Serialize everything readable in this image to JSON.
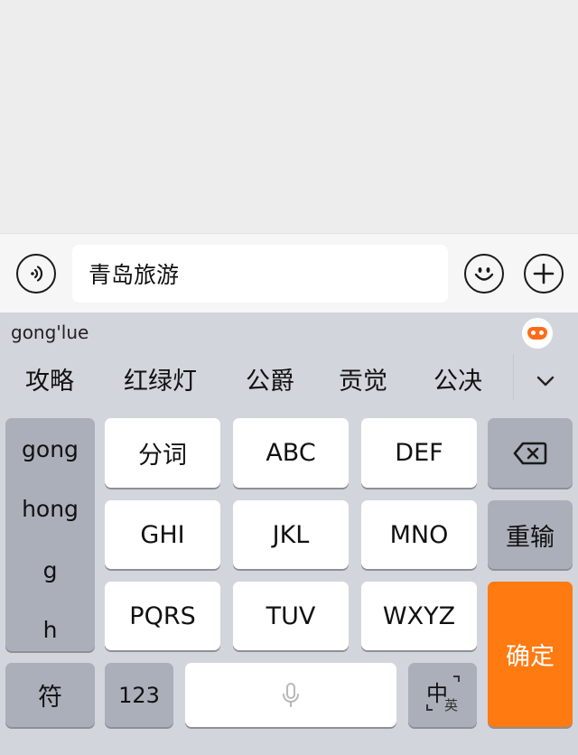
{
  "input_bar": {
    "text": "青岛旅游",
    "voice_icon": "voice-icon",
    "emoji_icon": "emoji-icon",
    "plus_icon": "plus-icon"
  },
  "keyboard": {
    "pinyin": "gong'lue",
    "candidates": [
      "攻略",
      "红绿灯",
      "公爵",
      "贡觉",
      "公决"
    ],
    "side_list": [
      "gong",
      "hong",
      "g",
      "h"
    ],
    "keys": {
      "word": "分词",
      "abc": "ABC",
      "def": "DEF",
      "ghi": "GHI",
      "jkl": "JKL",
      "mno": "MNO",
      "pqrs": "PQRS",
      "tuv": "TUV",
      "wxyz": "WXYZ",
      "retype": "重输",
      "confirm": "确定",
      "symbol": "符",
      "num": "123",
      "lang_main": "中",
      "lang_sub": "英"
    },
    "colors": {
      "accent": "#ff7a11",
      "key_dark": "#abafba",
      "key_light": "#ffffff"
    }
  }
}
